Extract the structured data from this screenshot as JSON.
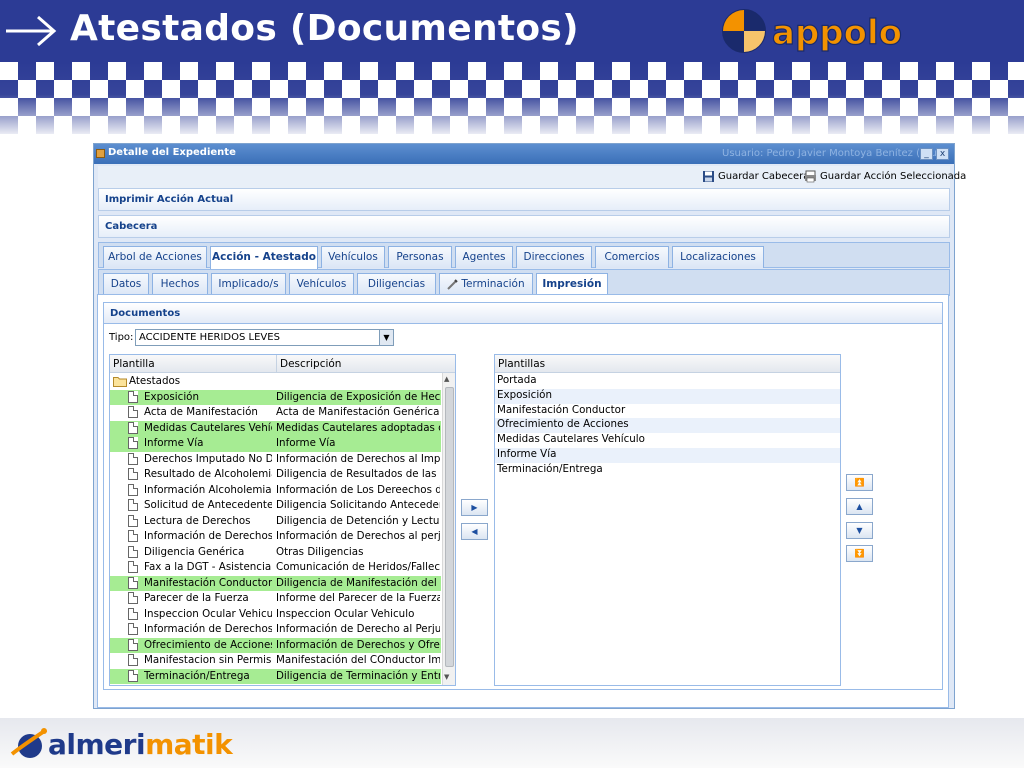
{
  "slide": {
    "title": "Atestados (Documentos)",
    "logo_text": "appolo",
    "footer_logo": {
      "prefix": "almeri",
      "suffix": "matik"
    }
  },
  "window": {
    "title": "Detalle del Expediente",
    "user": "Usuario: Pedro Javier Montoya Benítez (prue",
    "minimize": "_",
    "close": "x"
  },
  "toolbar": {
    "save_header": "Guardar Cabecera",
    "save_action": "Guardar Acción Seleccionada"
  },
  "panels": {
    "print_action": "Imprimir Acción Actual",
    "header": "Cabecera"
  },
  "main_tabs": [
    {
      "label": "Arbol de Acciones"
    },
    {
      "label": "Acción - Atestado"
    },
    {
      "label": "Vehículos"
    },
    {
      "label": "Personas"
    },
    {
      "label": "Agentes"
    },
    {
      "label": "Direcciones"
    },
    {
      "label": "Comercios"
    },
    {
      "label": "Localizaciones"
    }
  ],
  "sub_tabs": [
    {
      "label": "Datos"
    },
    {
      "label": "Hechos"
    },
    {
      "label": "Implicado/s"
    },
    {
      "label": "Vehículos"
    },
    {
      "label": "Diligencias"
    },
    {
      "label": "Terminación"
    },
    {
      "label": "Impresión"
    }
  ],
  "documents": {
    "panel_title": "Documentos",
    "type_label": "Tipo:",
    "type_value": "ACCIDENTE HERIDOS LEVES",
    "grid": {
      "columns": [
        "Plantilla",
        "Descripción"
      ],
      "folder": "Atestados",
      "rows": [
        {
          "plantilla": "Exposición",
          "descripcion": "Diligencia de Exposición de Hecho",
          "selected": true
        },
        {
          "plantilla": "Acta de Manifestación",
          "descripcion": "Acta de Manifestación Genérica",
          "selected": false
        },
        {
          "plantilla": "Medidas Cautelares Vehículo",
          "descripcion": "Medidas Cautelares adoptadas co",
          "selected": true
        },
        {
          "plantilla": "Informe Vía",
          "descripcion": "Informe Vía",
          "selected": true
        },
        {
          "plantilla": "Derechos Imputado No Detenido",
          "descripcion": "Información de Derechos al Imputa",
          "selected": false
        },
        {
          "plantilla": "Resultado de Alcoholemia",
          "descripcion": "Diligencia de Resultados de las P",
          "selected": false
        },
        {
          "plantilla": "Información Alcoholemia",
          "descripcion": "Información de Los Dereechos de",
          "selected": false
        },
        {
          "plantilla": "Solicitud de Antecedentes",
          "descripcion": "Diligencia Solicitando Antecedente",
          "selected": false
        },
        {
          "plantilla": "Lectura de Derechos",
          "descripcion": "Diligencia de Detención y Lectura d",
          "selected": false
        },
        {
          "plantilla": "Información de Derechos D",
          "descripcion": "Información de Derechos al perjuc",
          "selected": false
        },
        {
          "plantilla": "Diligencia Genérica",
          "descripcion": "Otras Diligencias",
          "selected": false
        },
        {
          "plantilla": "Fax a la DGT - Asistencia S",
          "descripcion": "Comunicación de Heridos/Fallecio",
          "selected": false
        },
        {
          "plantilla": "Manifestación Conductor",
          "descripcion": "Diligencia de Manifestación del Co",
          "selected": true
        },
        {
          "plantilla": "Parecer de la Fuerza",
          "descripcion": "Informe del Parecer de la Fuerza e",
          "selected": false
        },
        {
          "plantilla": "Inspeccion Ocular Vehiculo",
          "descripcion": "Inspeccion Ocular Vehiculo",
          "selected": false
        },
        {
          "plantilla": "Información de Derechos P",
          "descripcion": "Información de Derecho al Perjudi",
          "selected": false
        },
        {
          "plantilla": "Ofrecimiento de Acciones",
          "descripcion": "Información de Derechos y Ofrecin",
          "selected": true
        },
        {
          "plantilla": "Manifestacion sin Permiso",
          "descripcion": "Manifestación del COnductor Impu",
          "selected": false
        },
        {
          "plantilla": "Terminación/Entrega",
          "descripcion": "Diligencia de Terminación y Entreg",
          "selected": true
        }
      ]
    },
    "plantillas": {
      "column": "Plantillas",
      "items": [
        "Portada",
        "Exposición",
        "Manifestación Conductor",
        "Ofrecimiento de Acciones",
        "Medidas Cautelares Vehículo",
        "Informe Vía",
        "Terminación/Entrega"
      ]
    }
  },
  "icons": {
    "transfer_right": "triangle-right",
    "transfer_left": "triangle-left",
    "move_top": "double-up",
    "move_up": "up",
    "move_down": "down",
    "move_bottom": "double-down"
  }
}
